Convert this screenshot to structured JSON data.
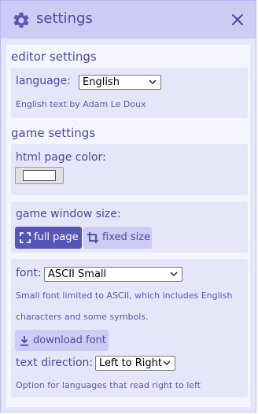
{
  "header": {
    "title": "settings",
    "icon": "gear-icon",
    "close_icon": "close-icon"
  },
  "editor_settings": {
    "heading": "editor settings",
    "language_label": "language:",
    "language_value": "English",
    "language_note": "English text by Adam Le Doux"
  },
  "game_settings": {
    "heading": "game settings",
    "page_color_label": "html page color:",
    "page_color_value": "#ffffff",
    "window_size_label": "game window size:",
    "full_page_label": "full page",
    "fixed_size_label": "fixed size",
    "font_label": "font:",
    "font_value": "ASCII Small",
    "font_note_line1": "Small font limited to ASCII, which includes English",
    "font_note_line2": "characters and some symbols.",
    "download_font_label": "download font",
    "text_direction_label": "text direction:",
    "text_direction_value": "Left to Right",
    "text_direction_note": "Option for languages that read right to left"
  },
  "colors": {
    "accent": "#5656b8",
    "text": "#4a4aa0",
    "panel_bg": "#e6e6fa",
    "title_bg": "#ccccf5"
  }
}
